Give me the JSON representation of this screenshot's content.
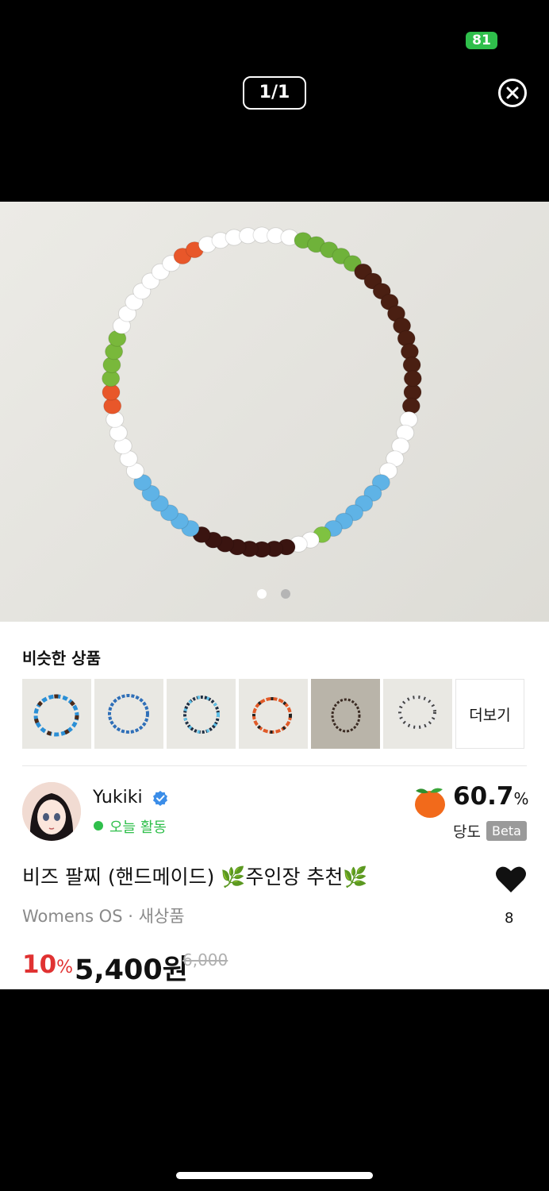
{
  "status_bar": {
    "battery": "81"
  },
  "viewer": {
    "counter": "1/1"
  },
  "similar": {
    "title": "비슷한 상품",
    "more_label": "더보기"
  },
  "seller": {
    "name": "Yukiki",
    "activity": "오늘 활동"
  },
  "sweetness": {
    "value": "60.7",
    "unit": "%",
    "label": "당도",
    "badge": "Beta"
  },
  "product": {
    "title": "비즈 팔찌 (핸드메이드) 🌿주인장 추천🌿",
    "meta": "Womens OS · 새상품",
    "likes": "8",
    "discount": "10",
    "discount_unit": "%",
    "price": "5,400원",
    "original_price": "6,000"
  },
  "colors": {
    "accent_green": "#2fbf4b",
    "discount_red": "#e03232"
  }
}
